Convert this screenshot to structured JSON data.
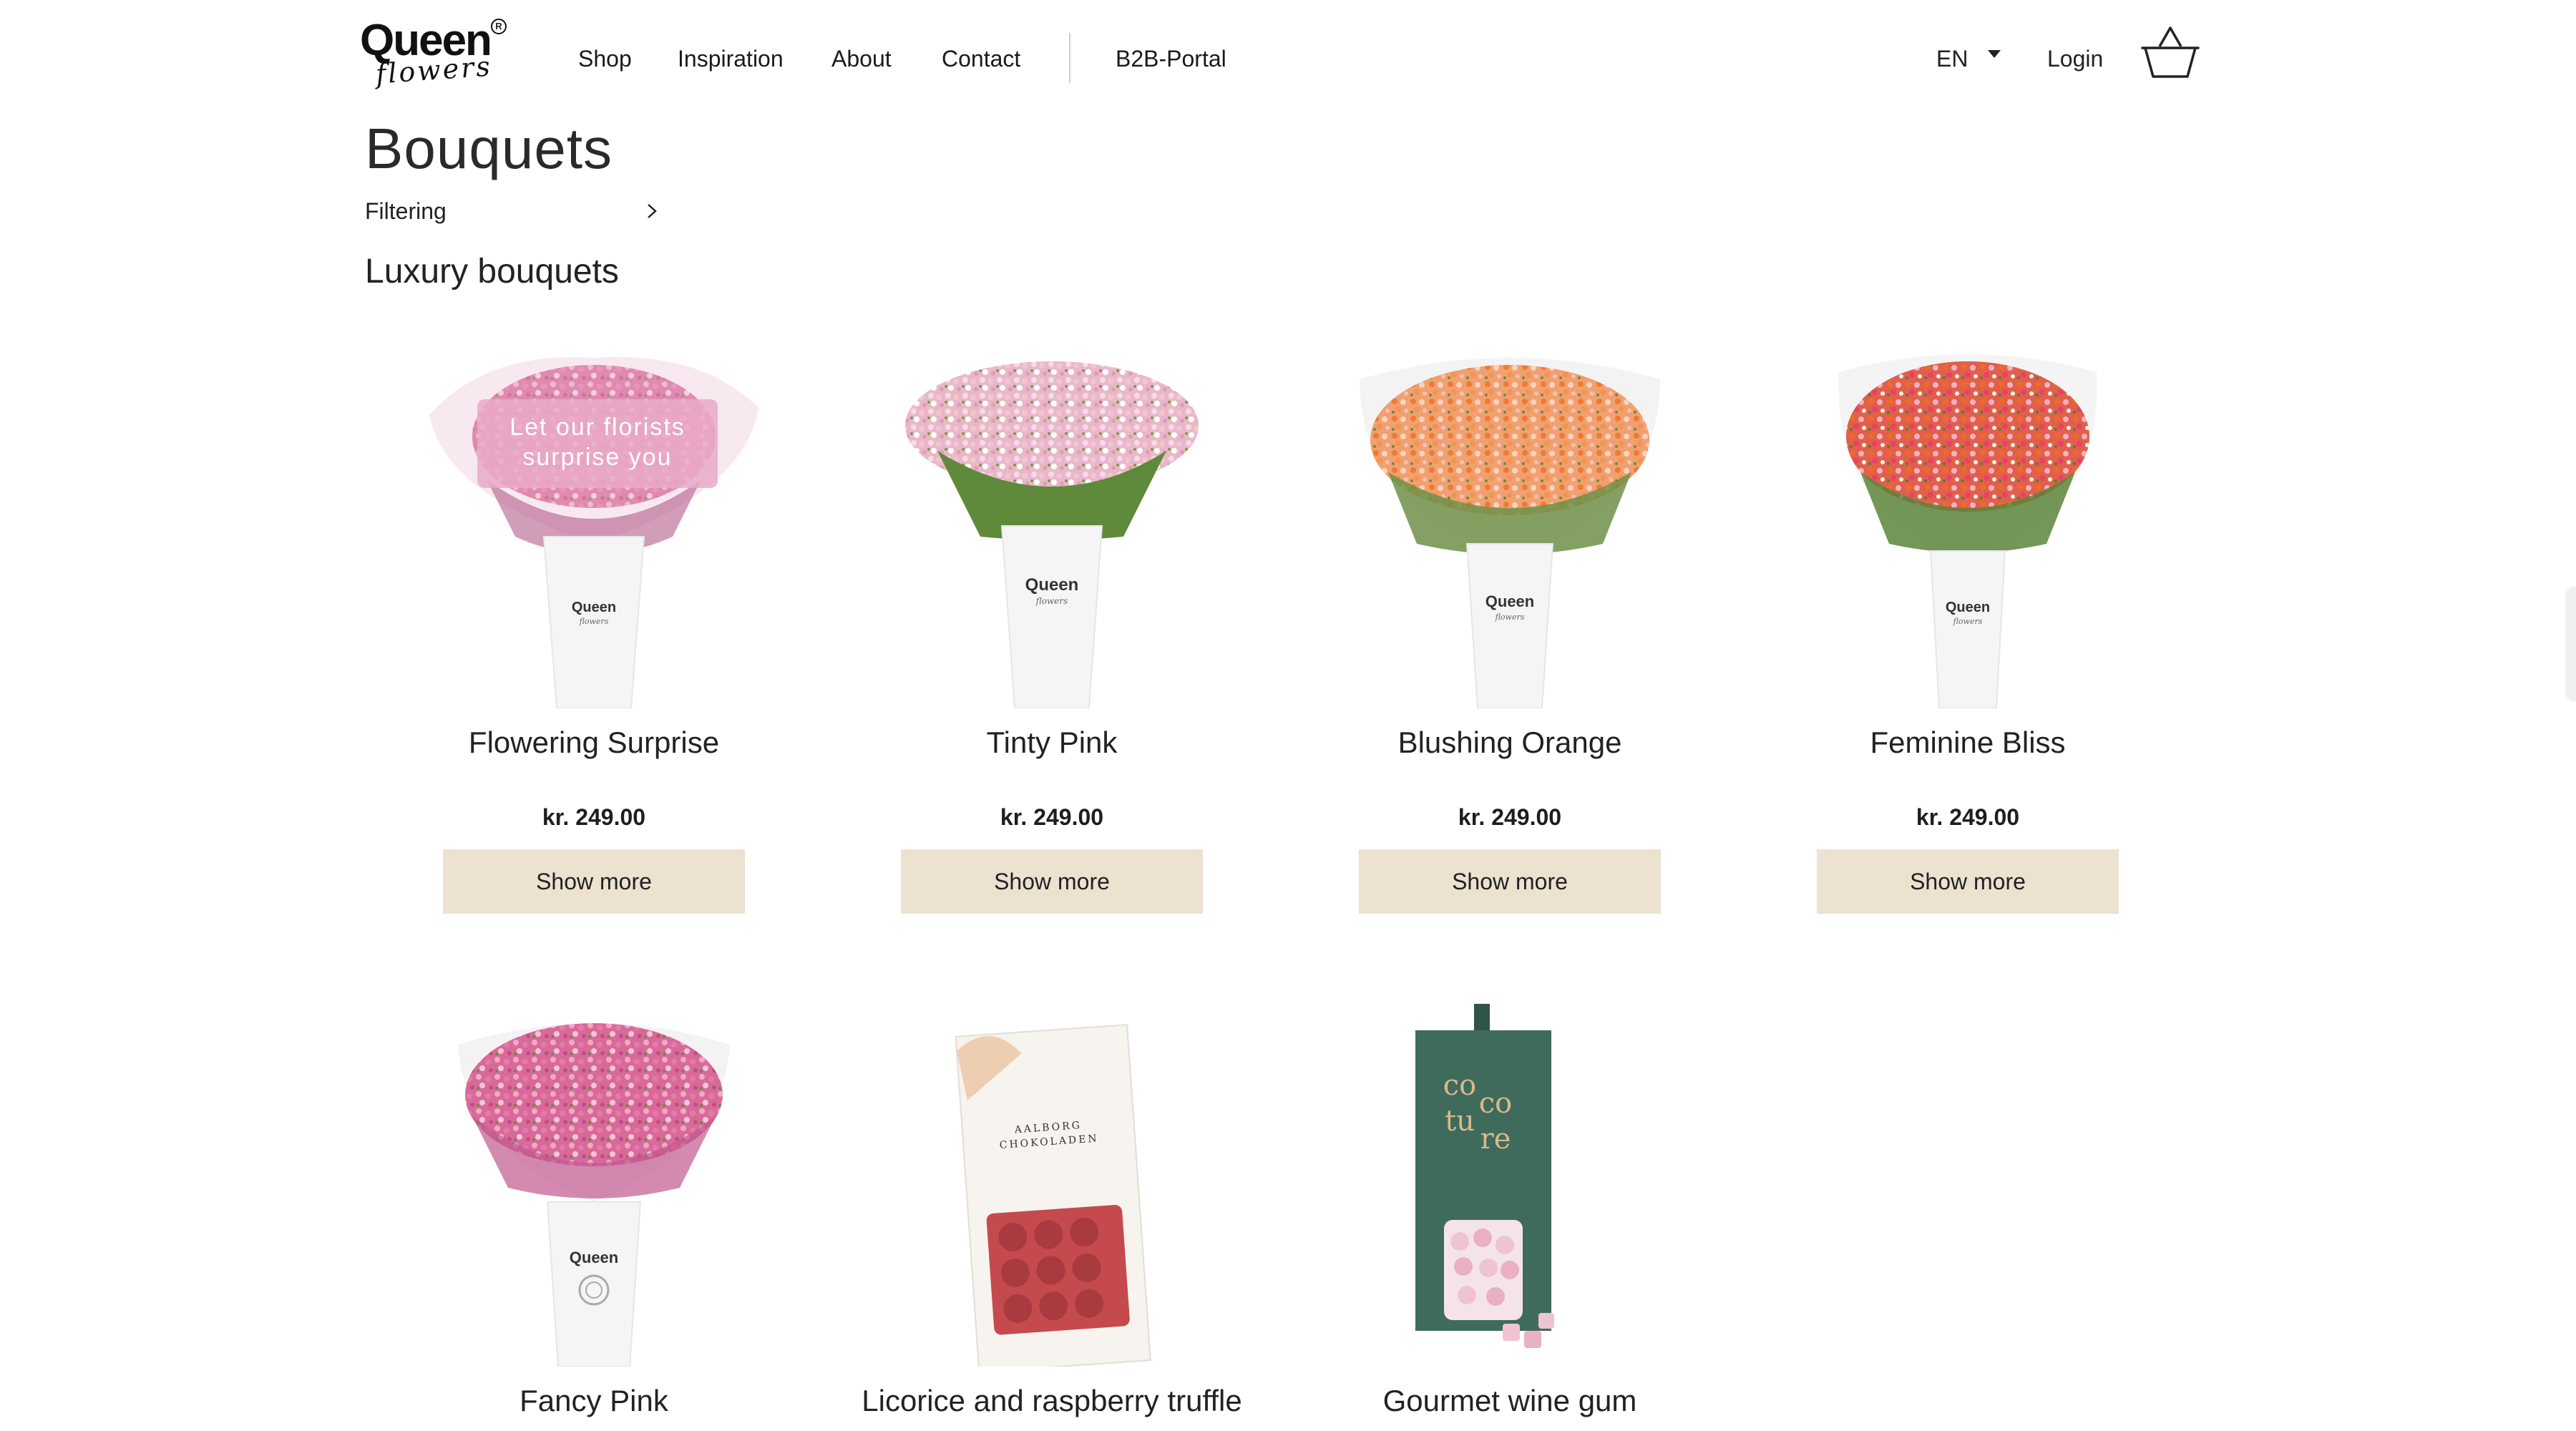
{
  "header": {
    "logo": {
      "word": "Queen",
      "script": "flowers",
      "reg": "R"
    },
    "nav": [
      {
        "label": "Shop"
      },
      {
        "label": "Inspiration"
      },
      {
        "label": "About"
      },
      {
        "label": "Contact"
      },
      {
        "label": "B2B-Portal"
      }
    ],
    "language": "EN",
    "login_label": "Login"
  },
  "page": {
    "title": "Bouquets",
    "filtering_label": "Filtering",
    "section_title": "Luxury bouquets"
  },
  "colors": {
    "button_bg": "#ede1d0",
    "text": "#222222",
    "badge_pink": "#e9aac8"
  },
  "products": [
    {
      "name": "Flowering Surprise",
      "price": "kr. 249.00",
      "button": "Show more",
      "badge_line1": "Let our florists",
      "badge_line2": "surprise you",
      "image": "bouquet-pink-surprise"
    },
    {
      "name": "Tinty Pink",
      "price": "kr. 249.00",
      "button": "Show more",
      "image": "bouquet-light-pink"
    },
    {
      "name": "Blushing Orange",
      "price": "kr. 249.00",
      "button": "Show more",
      "image": "bouquet-orange-pink"
    },
    {
      "name": "Feminine Bliss",
      "price": "kr. 249.00",
      "button": "Show more",
      "image": "bouquet-orange-red"
    },
    {
      "name": "Fancy Pink",
      "image": "bouquet-fancy-pink"
    },
    {
      "name": "Licorice and raspberry truffle",
      "image": "chocolate-box",
      "packaging_text": {
        "brand": "AALBORG",
        "brand2": "CHOKOLADEN"
      }
    },
    {
      "name": "Gourmet wine gum",
      "image": "wine-gum-box",
      "packaging_text": {
        "l1": "co",
        "l2": "co",
        "l3": "tu",
        "l4": "re"
      }
    }
  ]
}
